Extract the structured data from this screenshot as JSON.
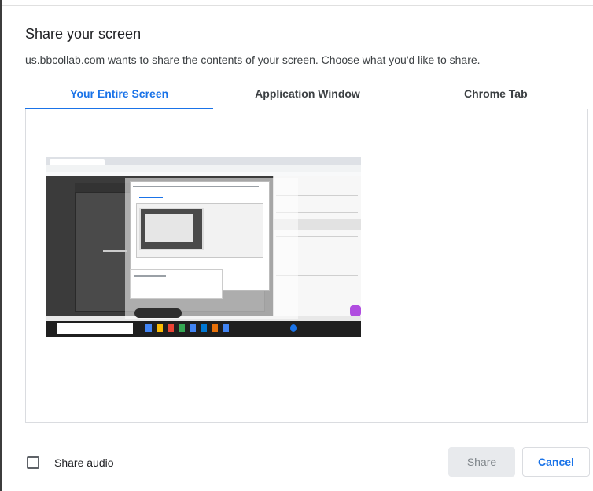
{
  "dialog": {
    "title": "Share your screen",
    "subtitle": "us.bbcollab.com wants to share the contents of your screen. Choose what you'd like to share."
  },
  "tabs": [
    {
      "label": "Your Entire Screen",
      "active": true
    },
    {
      "label": "Application Window",
      "active": false
    },
    {
      "label": "Chrome Tab",
      "active": false
    }
  ],
  "screen_thumbnail": {
    "selected": false
  },
  "footer": {
    "share_audio_label": "Share audio",
    "share_audio_checked": false,
    "share_label": "Share",
    "cancel_label": "Cancel"
  },
  "colors": {
    "accent": "#1a73e8",
    "disabled_bg": "#e8eaed",
    "disabled_text": "#80868b"
  }
}
